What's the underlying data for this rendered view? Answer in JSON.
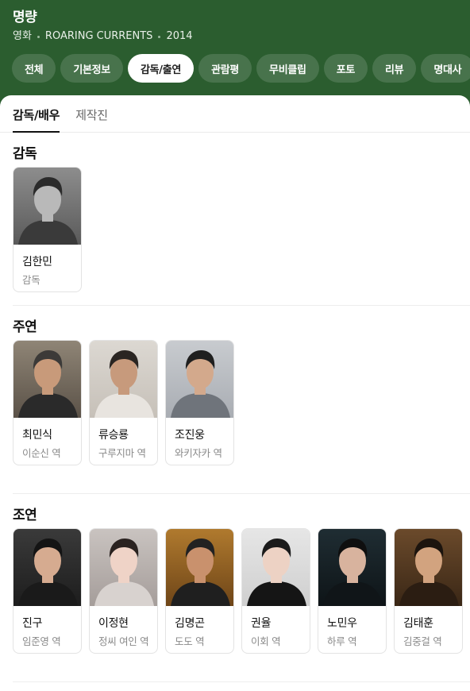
{
  "header": {
    "title": "명량",
    "meta": [
      "영화",
      "ROARING CURRENTS",
      "2014"
    ]
  },
  "tabs": [
    {
      "label": "전체",
      "active": false
    },
    {
      "label": "기본정보",
      "active": false
    },
    {
      "label": "감독/출연",
      "active": true
    },
    {
      "label": "관람평",
      "active": false
    },
    {
      "label": "무비클립",
      "active": false
    },
    {
      "label": "포토",
      "active": false
    },
    {
      "label": "리뷰",
      "active": false
    },
    {
      "label": "명대사",
      "active": false
    }
  ],
  "subtabs": [
    {
      "label": "감독/배우",
      "active": true
    },
    {
      "label": "제작진",
      "active": false
    }
  ],
  "sections": [
    {
      "title": "감독",
      "people": [
        {
          "name": "김한민",
          "role": "감독",
          "tone": "bw"
        }
      ]
    },
    {
      "title": "주연",
      "people": [
        {
          "name": "최민식",
          "role": "이순신 역",
          "tone": "warm"
        },
        {
          "name": "류승룡",
          "role": "구루지마 역",
          "tone": "light"
        },
        {
          "name": "조진웅",
          "role": "와키자카 역",
          "tone": "grey"
        }
      ]
    },
    {
      "title": "조연",
      "people": [
        {
          "name": "진구",
          "role": "임준영 역",
          "tone": "dark"
        },
        {
          "name": "이정현",
          "role": "정씨 여인 역",
          "tone": "soft"
        },
        {
          "name": "김명곤",
          "role": "도도 역",
          "tone": "amber"
        },
        {
          "name": "권율",
          "role": "이회 역",
          "tone": "pale"
        },
        {
          "name": "노민우",
          "role": "하루 역",
          "tone": "teal"
        },
        {
          "name": "김태훈",
          "role": "김중걸 역",
          "tone": "brown"
        }
      ]
    }
  ],
  "colors": {
    "header_bg": "#2b5d2f",
    "active_tab_bg": "#ffffff",
    "card_border": "#e3e3e3",
    "role_text": "#8a8a8a"
  }
}
